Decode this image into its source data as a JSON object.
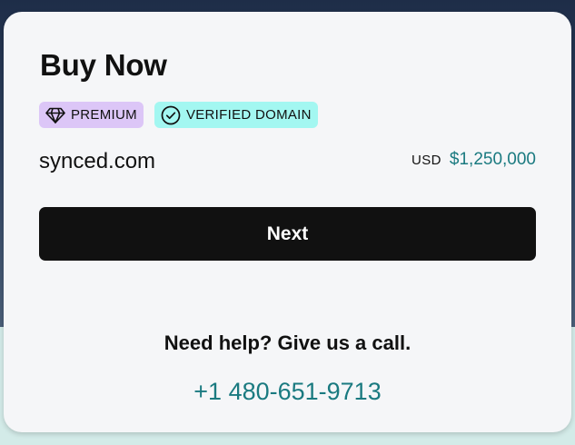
{
  "card": {
    "title": "Buy Now",
    "badges": [
      {
        "label": "PREMIUM",
        "icon": "diamond-icon",
        "color": "#dcc6f7"
      },
      {
        "label": "VERIFIED DOMAIN",
        "icon": "check-circle-icon",
        "color": "#a3f7f1"
      }
    ],
    "domain": "synced.com",
    "price": {
      "currency": "USD",
      "amount": "$1,250,000",
      "color": "#1a7a80"
    },
    "next_label": "Next",
    "help_text": "Need help? Give us a call.",
    "phone": "+1 480-651-9713"
  }
}
